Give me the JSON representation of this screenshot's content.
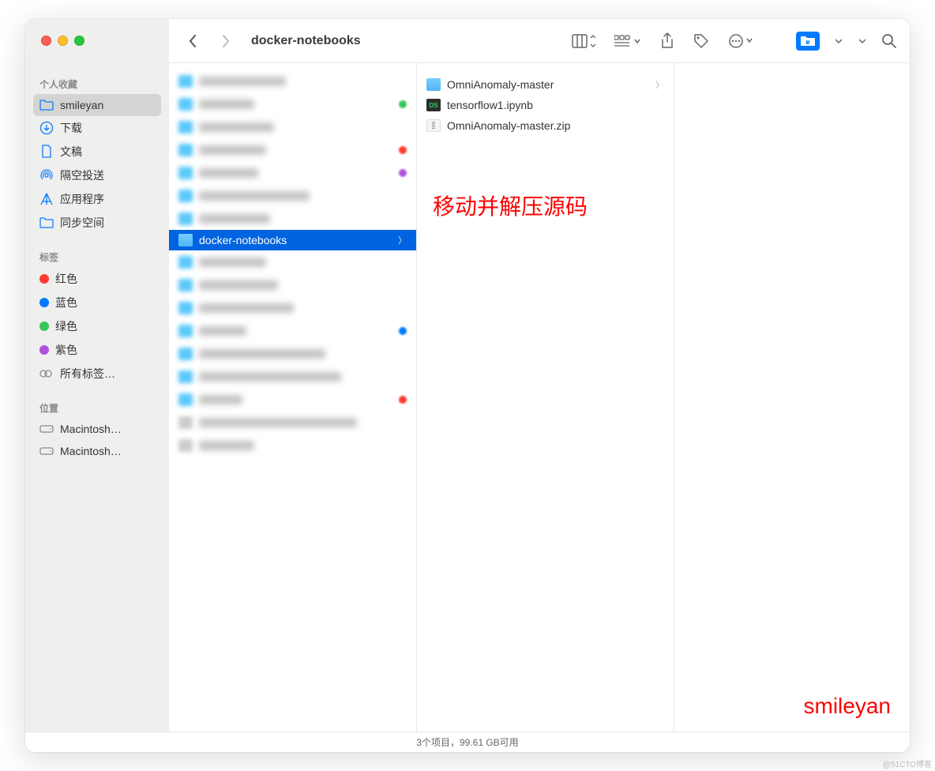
{
  "window": {
    "title": "docker-notebooks"
  },
  "traffic": {
    "close": "close",
    "min": "minimize",
    "max": "maximize"
  },
  "sidebar": {
    "favorites_header": "个人收藏",
    "favorites": [
      {
        "icon": "folder",
        "label": "smileyan",
        "selected": true
      },
      {
        "icon": "download",
        "label": "下载"
      },
      {
        "icon": "document",
        "label": "文稿"
      },
      {
        "icon": "airdrop",
        "label": "隔空投送"
      },
      {
        "icon": "app",
        "label": "应用程序"
      },
      {
        "icon": "sync",
        "label": "同步空间"
      }
    ],
    "tags_header": "标签",
    "tags": [
      {
        "color": "#ff3b30",
        "label": "红色"
      },
      {
        "color": "#007aff",
        "label": "蓝色"
      },
      {
        "color": "#34c759",
        "label": "绿色"
      },
      {
        "color": "#af52de",
        "label": "紫色"
      }
    ],
    "all_tags": "所有标签…",
    "locations_header": "位置",
    "locations": [
      {
        "label": "Macintosh…"
      },
      {
        "label": "Macintosh…"
      }
    ]
  },
  "column1": {
    "selected_folder": "docker-notebooks"
  },
  "column2": {
    "items": [
      {
        "type": "folder",
        "name": "OmniAnomaly-master",
        "has_children": true
      },
      {
        "type": "ipynb",
        "name": "tensorflow1.ipynb"
      },
      {
        "type": "zip",
        "name": "OmniAnomaly-master.zip"
      }
    ]
  },
  "annotations": {
    "instruction": "移动并解压源码",
    "author": "smileyan"
  },
  "statusbar": {
    "text": "3个项目，99.61 GB可用"
  },
  "watermark": "@51CTO博客"
}
